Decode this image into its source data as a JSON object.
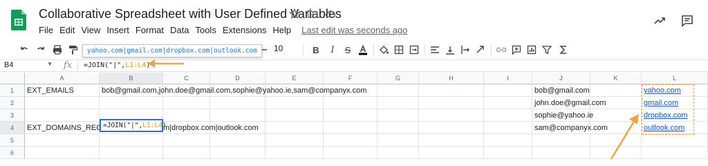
{
  "app": {
    "title": "Collaborative Spreadsheet with User Defined Variables",
    "last_edit": "Last edit was seconds ago",
    "menu": [
      "File",
      "Edit",
      "View",
      "Insert",
      "Format",
      "Data",
      "Tools",
      "Extensions",
      "Help"
    ]
  },
  "icons": [
    "star-icon",
    "move-folder-icon",
    "cloud-status-icon",
    "trend-icon",
    "comment-icon"
  ],
  "toolbar": {
    "font_size": "10",
    "tooltip": "yahoo.com|gmail.com|dropbox.com|outlook.com"
  },
  "formula_bar": {
    "name_box": "B4",
    "fx": "fx",
    "formula_prefix": "=JOIN(\"|\",",
    "formula_ref": "L1:L4",
    "formula_suffix": ")"
  },
  "columns": [
    "A",
    "B",
    "C",
    "D",
    "E",
    "F",
    "G",
    "H",
    "I",
    "J",
    "K",
    "L"
  ],
  "rows": [
    "1",
    "2",
    "3",
    "4",
    "5",
    "6"
  ],
  "cells": {
    "A1": "EXT_EMAILS",
    "B1": "bob@gmail.com,john.doe@gmail.com,sophie@yahoo.ie,sam@companyx.com",
    "A4": "EXT_DOMAINS_REG",
    "B4_overflow": "m|dropbox.com|outlook.com",
    "J": [
      "bob@gmail.com",
      "john.doe@gmail.com",
      "sophie@yahoo.ie",
      "sam@companyx.com"
    ],
    "L": [
      "yahoo.com",
      "gmail.com",
      "dropbox.com",
      "outlook.com"
    ]
  },
  "active_cell": {
    "prefix": "=JOIN(\"|\",",
    "ref": "L1:L4",
    "suffix": ")"
  },
  "colors": {
    "accent": "#1a73e8",
    "annotation": "#f5a142",
    "link": "#1155cc",
    "range_ref": "#f09300",
    "sheets_green": "#0f9d58"
  }
}
